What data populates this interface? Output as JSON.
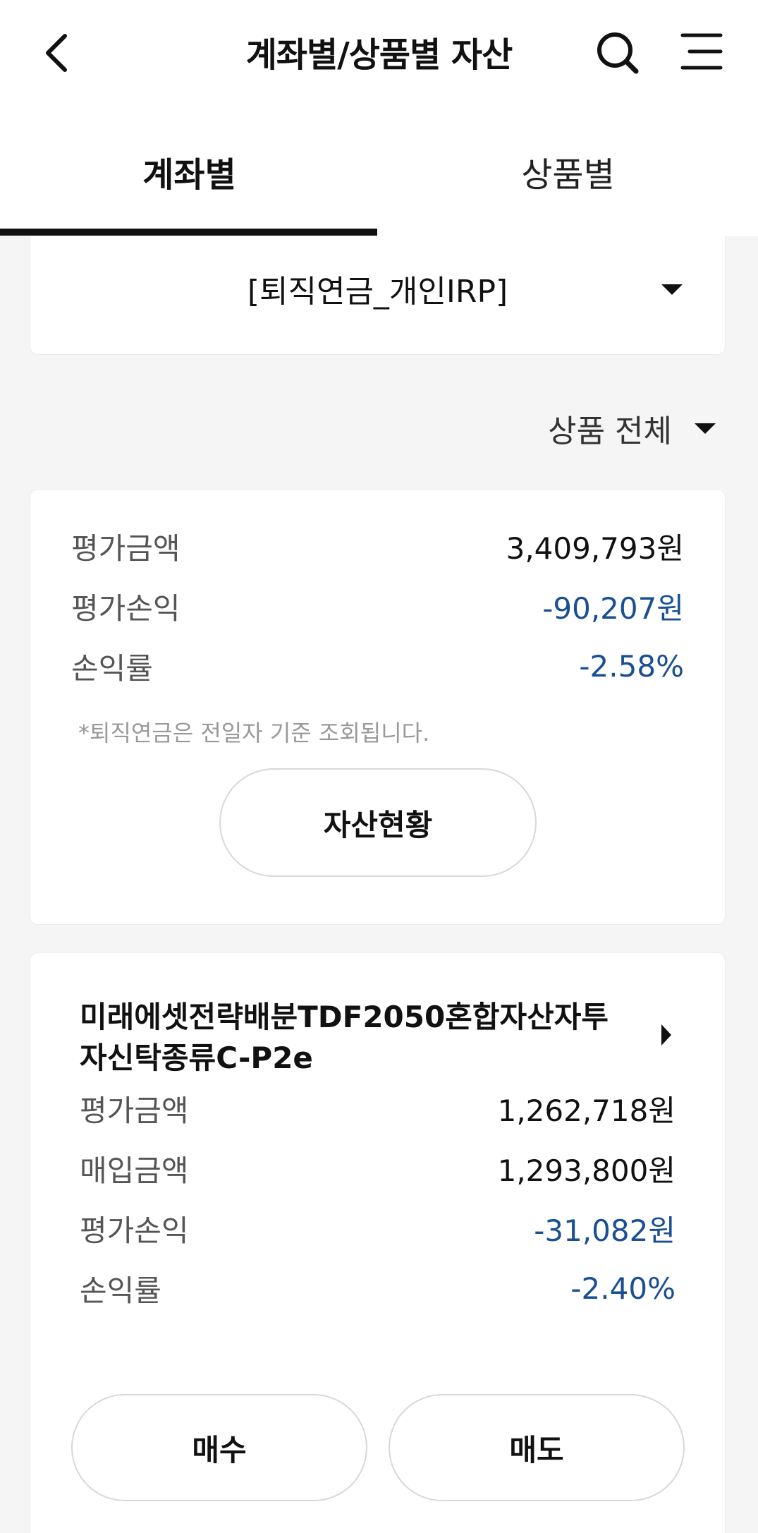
{
  "header": {
    "title": "계좌별/상품별 자산"
  },
  "tabs": [
    {
      "label": "계좌별",
      "active": true
    },
    {
      "label": "상품별",
      "active": false
    }
  ],
  "account": {
    "name": "[퇴직연금_개인IRP]"
  },
  "filter": {
    "label": "상품 전체"
  },
  "summary": {
    "eval_amount": {
      "label": "평가금액",
      "value": "3,409,793원"
    },
    "eval_pl": {
      "label": "평가손익",
      "value": "-90,207원"
    },
    "pl_rate": {
      "label": "손익률",
      "value": "-2.58%"
    },
    "note": "*퇴직연금은 전일자 기준 조회됩니다.",
    "asset_button": "자산현황"
  },
  "product": {
    "name": "미래에셋전략배분TDF2050혼합자산자투자신탁종류C-P2e",
    "eval_amount": {
      "label": "평가금액",
      "value": "1,262,718원"
    },
    "purchase_amount": {
      "label": "매입금액",
      "value": "1,293,800원"
    },
    "eval_pl": {
      "label": "평가손익",
      "value": "-31,082원"
    },
    "pl_rate": {
      "label": "손익률",
      "value": "-2.40%"
    },
    "buy_button": "매수",
    "sell_button": "매도"
  },
  "colors": {
    "negative": "#1a4f91",
    "accent": "#111111"
  },
  "icons": [
    "back-arrow-icon",
    "search-icon",
    "menu-icon",
    "caret-down-icon",
    "caret-right-icon"
  ]
}
